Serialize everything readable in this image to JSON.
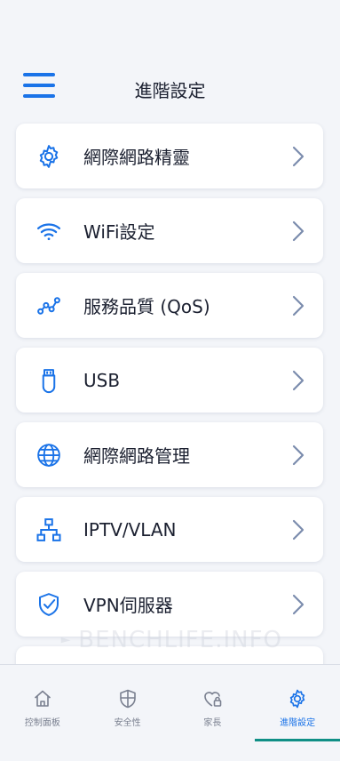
{
  "header": {
    "title": "進階設定"
  },
  "menu_items": [
    {
      "label": "網際網路精靈",
      "icon": "gear-icon"
    },
    {
      "label": "WiFi設定",
      "icon": "wifi-icon"
    },
    {
      "label": "服務品質 (QoS)",
      "icon": "qos-nodes-icon"
    },
    {
      "label": "USB",
      "icon": "usb-icon"
    },
    {
      "label": "網際網路管理",
      "icon": "globe-icon"
    },
    {
      "label": "IPTV/VLAN",
      "icon": "network-tree-icon"
    },
    {
      "label": "VPN伺服器",
      "icon": "shield-check-icon"
    }
  ],
  "watermark": "BENCHLIFE.INFO",
  "bottom_nav": [
    {
      "label": "控制面板",
      "icon": "home-icon",
      "active": false
    },
    {
      "label": "安全性",
      "icon": "shield-icon",
      "active": false
    },
    {
      "label": "家長",
      "icon": "heart-lock-icon",
      "active": false
    },
    {
      "label": "進階設定",
      "icon": "gear-icon",
      "active": true
    }
  ],
  "colors": {
    "accent": "#1a73e8",
    "active_indicator": "#0f8f86",
    "background": "#f3f5f9"
  }
}
